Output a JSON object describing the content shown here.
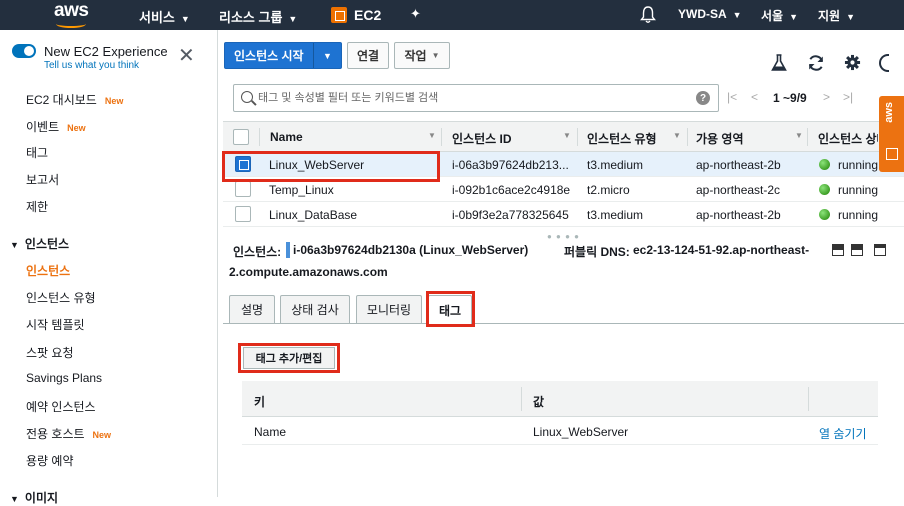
{
  "topbar": {
    "logo_text": "aws",
    "services": "서비스",
    "resource_groups": "리소스 그룹",
    "ec2_label": "EC2",
    "pin_glyph": "✦",
    "account": "YWD-SA",
    "region": "서울",
    "support": "지원",
    "icons": {
      "bell": "bell-icon",
      "pin": "pin-icon",
      "service": "ec2-service-icon"
    }
  },
  "sidebar": {
    "experience_title": "New EC2 Experience",
    "experience_sub": "Tell us what you think",
    "close_glyph": "✕",
    "new_badge": "New",
    "items": [
      {
        "label": "EC2 대시보드",
        "new": true
      },
      {
        "label": "이벤트",
        "new": true
      },
      {
        "label": "태그"
      },
      {
        "label": "보고서"
      },
      {
        "label": "제한"
      }
    ],
    "group_instances": "인스턴스",
    "instance_items": [
      {
        "label": "인스턴스",
        "active": true
      },
      {
        "label": "인스턴스 유형"
      },
      {
        "label": "시작 템플릿"
      },
      {
        "label": "스팟 요청"
      },
      {
        "label": "Savings Plans"
      },
      {
        "label": "예약 인스턴스"
      },
      {
        "label": "전용 호스트",
        "new": true
      },
      {
        "label": "용량 예약"
      }
    ],
    "group_images": "이미지"
  },
  "toolbar": {
    "launch_label": "인스턴스 시작",
    "connect_label": "연결",
    "actions_label": "작업",
    "caret": "▼"
  },
  "search": {
    "placeholder": "태그 및 속성별 필터 또는 키워드별 검색",
    "help_glyph": "?",
    "pager_label": "1 ~9/9",
    "pager_first": "|<",
    "pager_prev": "<",
    "pager_next": ">",
    "pager_last": ">|"
  },
  "table": {
    "columns": [
      "Name",
      "인스턴스 ID",
      "인스턴스 유형",
      "가용 영역",
      "인스턴스 상태"
    ],
    "rows": [
      {
        "name": "Linux_WebServer",
        "id": "i-06a3b97624db213...",
        "type": "t3.medium",
        "az": "ap-northeast-2b",
        "state": "running",
        "selected": true
      },
      {
        "name": "Temp_Linux",
        "id": "i-092b1c6ace2c4918e",
        "type": "t2.micro",
        "az": "ap-northeast-2c",
        "state": "running"
      },
      {
        "name": "Linux_DataBase",
        "id": "i-0b9f3e2a778325645",
        "type": "t3.medium",
        "az": "ap-northeast-2b",
        "state": "running"
      }
    ]
  },
  "detail": {
    "instance_label": "인스턴스:",
    "instance_value": "i-06a3b97624db2130a (Linux_WebServer)",
    "dns_label": "퍼블릭 DNS:",
    "dns_value_1": "ec2-13-124-51-92.ap-northeast-",
    "dns_value_2": "2.compute.amazonaws.com",
    "tabs": [
      "설명",
      "상태 검사",
      "모니터링",
      "태그"
    ],
    "active_tab": "태그",
    "add_tag_button": "태그 추가/편집",
    "tag_table": {
      "col_key": "키",
      "col_value": "값",
      "rows": [
        {
          "key": "Name",
          "value": "Linux_WebServer",
          "action": "열 숨기기"
        }
      ]
    }
  },
  "side_badge": "aws",
  "colors": {
    "nav_bg": "#232f3e",
    "accent_orange": "#ec7211",
    "primary_blue": "#1e73d2",
    "highlight_red": "#e02b1a",
    "running_green": "#1d8102"
  }
}
